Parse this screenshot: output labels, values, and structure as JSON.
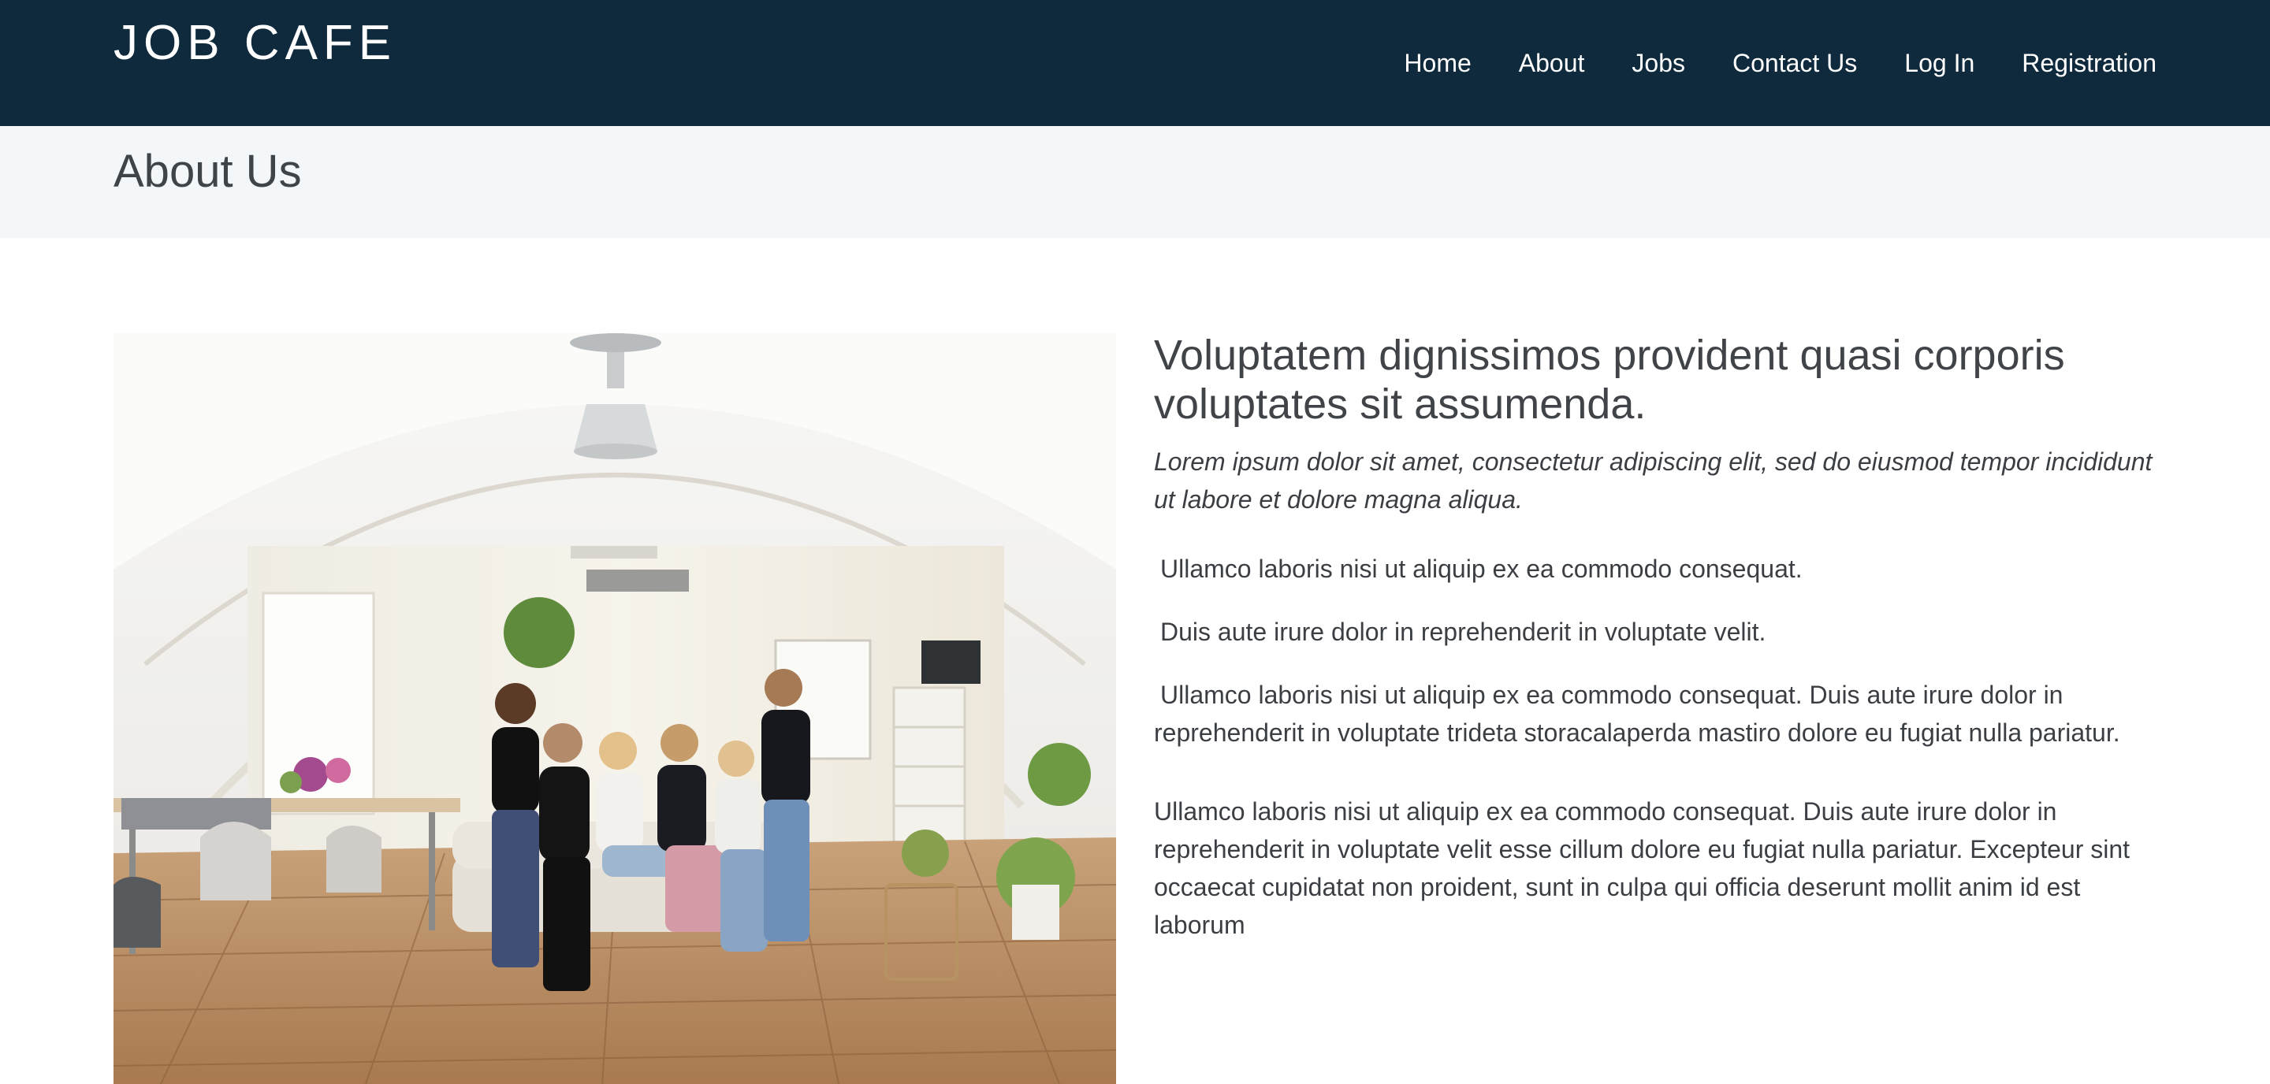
{
  "header": {
    "brand": "JOB CAFE",
    "nav": [
      "Home",
      "About",
      "Jobs",
      "Contact Us",
      "Log In",
      "Registration"
    ]
  },
  "subheader": {
    "title": "About Us"
  },
  "main": {
    "image_alt": "Team of six women sitting on a couch in a bright office",
    "heading": "Voluptatem dignissimos provident quasi corporis voluptates sit assumenda.",
    "lead": "Lorem ipsum dolor sit amet, consectetur adipiscing elit, sed do eiusmod tempor incididunt ut labore et dolore magna aliqua.",
    "paragraphs": [
      "Ullamco laboris nisi ut aliquip ex ea commodo consequat.",
      "Duis aute irure dolor in reprehenderit in voluptate velit.",
      "Ullamco laboris nisi ut aliquip ex ea commodo consequat. Duis aute irure dolor in reprehenderit in voluptate trideta storacalaperda mastiro dolore eu fugiat nulla pariatur.",
      "Ullamco laboris nisi ut aliquip ex ea commodo consequat. Duis aute irure dolor in reprehenderit in voluptate velit esse cillum dolore eu fugiat nulla pariatur. Excepteur sint occaecat cupidatat non proident, sunt in culpa qui officia deserunt mollit anim id est laborum"
    ]
  },
  "colors": {
    "header_bg": "#0f2a3d",
    "subheader_bg": "#f3f7f9",
    "text": "#3b3f43"
  }
}
